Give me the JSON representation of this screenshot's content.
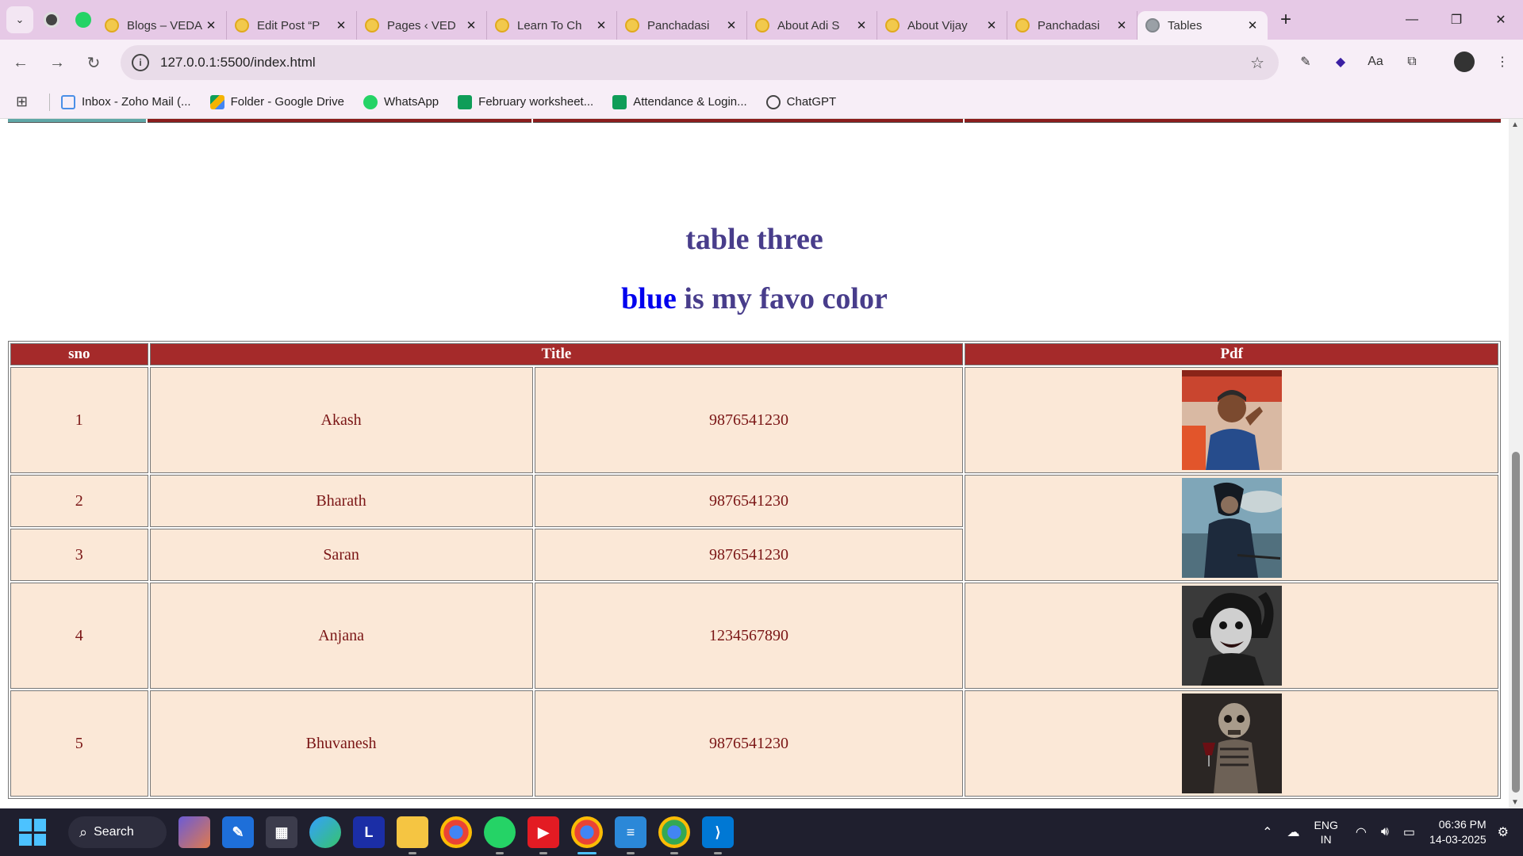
{
  "browser": {
    "tabs": [
      {
        "title": "Blogs – VEDA"
      },
      {
        "title": "Edit Post “P"
      },
      {
        "title": "Pages ‹ VED"
      },
      {
        "title": "Learn To Ch"
      },
      {
        "title": "Panchadasi"
      },
      {
        "title": "About Adi S"
      },
      {
        "title": "About Vijay"
      },
      {
        "title": "Panchadasi"
      },
      {
        "title": "Tables"
      }
    ],
    "url": "127.0.0.1:5500/index.html",
    "bookmarks": [
      {
        "label": "Inbox - Zoho Mail (...",
        "icon": "mail-icon",
        "color": "#4a8fe7"
      },
      {
        "label": "Folder - Google Drive",
        "icon": "drive-icon",
        "color": "#f4b400"
      },
      {
        "label": "WhatsApp",
        "icon": "whatsapp-icon",
        "color": "#25d366"
      },
      {
        "label": "February worksheet...",
        "icon": "sheets-icon",
        "color": "#0f9d58"
      },
      {
        "label": "Attendance & Login...",
        "icon": "sheets-icon",
        "color": "#0f9d58"
      },
      {
        "label": "ChatGPT",
        "icon": "chatgpt-icon",
        "color": "#444444"
      }
    ]
  },
  "page": {
    "heading": "table three",
    "subheading_blue": "blue",
    "subheading_rest": " is my favo color",
    "table": {
      "headers": [
        "sno",
        "Title",
        "Pdf"
      ],
      "rows": [
        {
          "sno": "1",
          "name": "Akash",
          "phone": "9876541230"
        },
        {
          "sno": "2",
          "name": "Bharath",
          "phone": "9876541230"
        },
        {
          "sno": "3",
          "name": "Saran",
          "phone": "9876541230"
        },
        {
          "sno": "4",
          "name": "Anjana",
          "phone": "1234567890"
        },
        {
          "sno": "5",
          "name": "Bhuvanesh",
          "phone": "9876541230"
        }
      ]
    }
  },
  "taskbar": {
    "search_label": "Search",
    "lang": "ENG",
    "region": "IN",
    "time": "06:36 PM",
    "date": "14-03-2025"
  },
  "colors": {
    "header_bg": "#a52a2a",
    "cell_bg": "#fbe8d7",
    "heading": "#483d8b",
    "accent_blue": "#0000ee"
  }
}
